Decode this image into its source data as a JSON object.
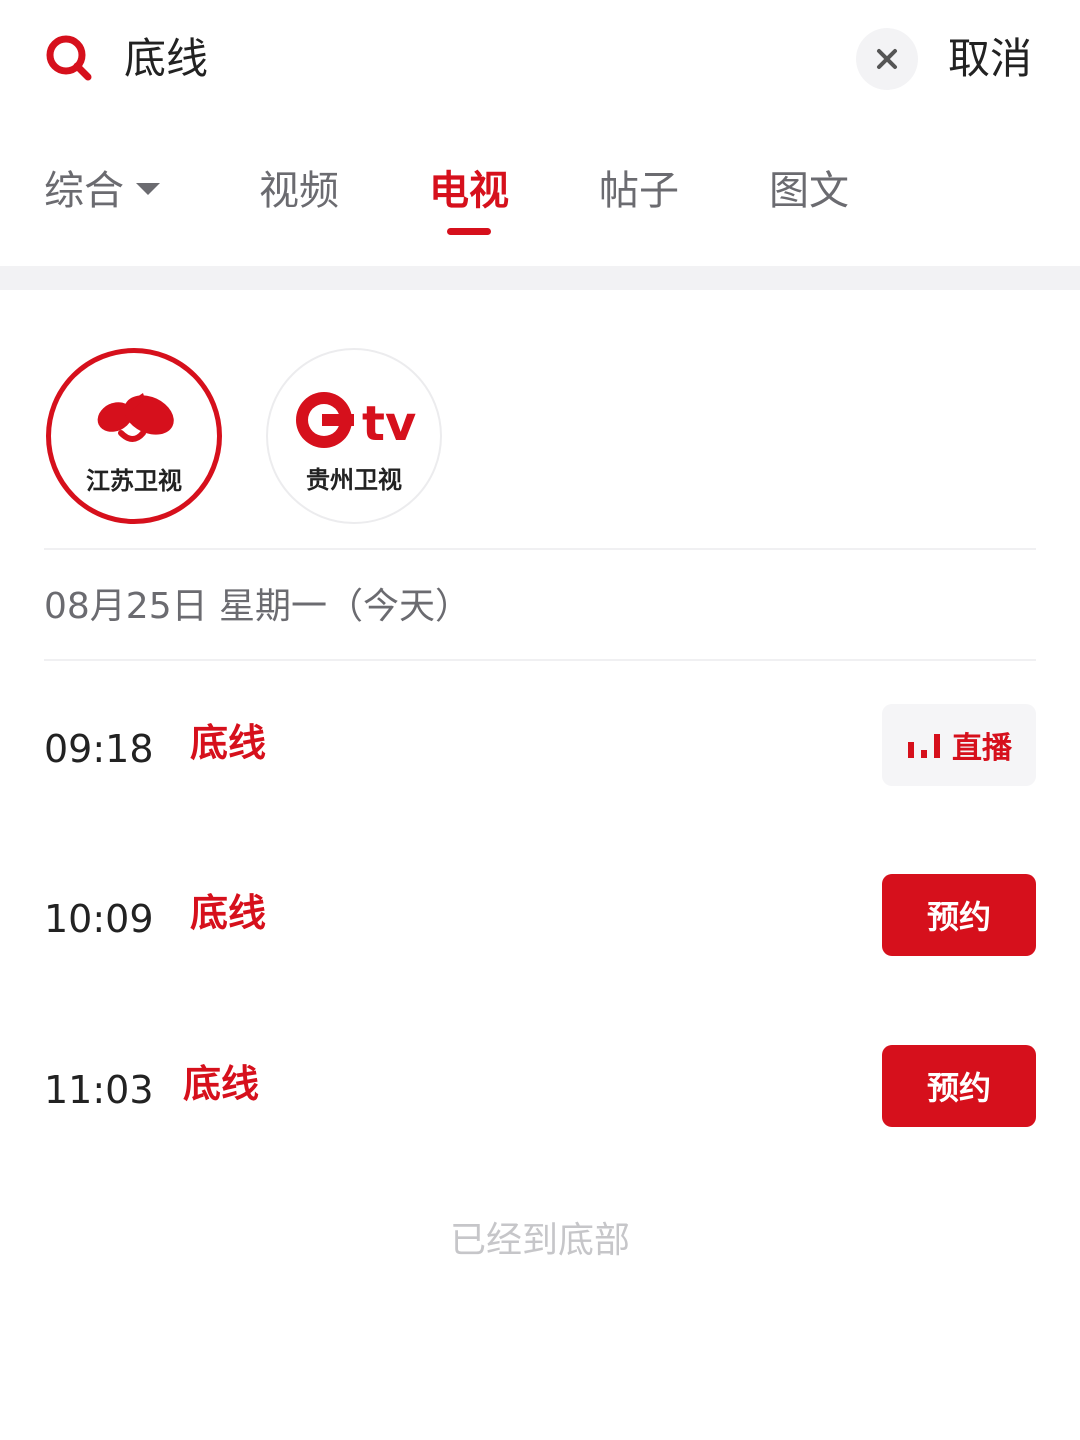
{
  "search": {
    "query": "底线",
    "cancel_label": "取消",
    "icons": {
      "search": "search-icon",
      "clear": "close-icon"
    }
  },
  "tabs": [
    {
      "label": "综合",
      "has_dropdown": true,
      "active": false
    },
    {
      "label": "视频",
      "active": false
    },
    {
      "label": "电视",
      "active": true
    },
    {
      "label": "帖子",
      "active": false
    },
    {
      "label": "图文",
      "active": false
    }
  ],
  "channels": [
    {
      "label": "江苏卫视",
      "selected": true
    },
    {
      "label": "贵州卫视",
      "logo_text": "tv",
      "selected": false
    }
  ],
  "date_header": "08月25日 星期一（今天）",
  "schedule": [
    {
      "time": "09:18",
      "title": "底线",
      "action": "直播",
      "action_type": "live"
    },
    {
      "time": "10:09",
      "title": "底线",
      "action": "预约",
      "action_type": "reserve"
    },
    {
      "time": "11:03",
      "title": "底线",
      "action": "预约",
      "action_type": "reserve"
    }
  ],
  "footer_note": "已经到底部",
  "colors": {
    "accent": "#d6101c",
    "text_primary": "#222222",
    "text_secondary": "#6b6b70",
    "band": "#f2f2f4"
  }
}
